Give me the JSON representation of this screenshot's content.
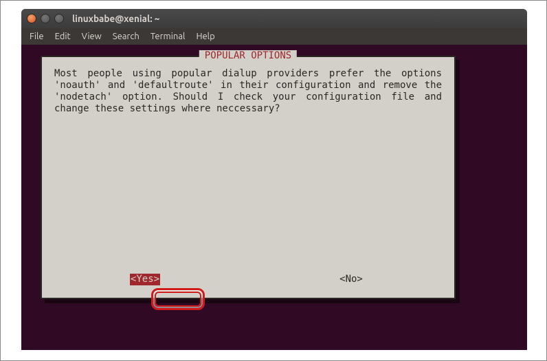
{
  "window": {
    "title": "linuxbabe@xenial: ~"
  },
  "menubar": {
    "items": [
      "File",
      "Edit",
      "View",
      "Search",
      "Terminal",
      "Help"
    ]
  },
  "dialog": {
    "title": "POPULAR OPTIONS",
    "body": "Most people using popular dialup providers prefer the options 'noauth' and 'defaultroute' in their configuration and remove the 'nodetach' option. Should I check your configuration file and change these settings where neccessary?",
    "yes_label": "<Yes>",
    "no_label": "<No>"
  }
}
